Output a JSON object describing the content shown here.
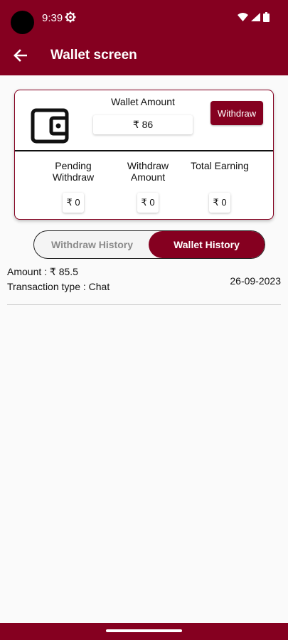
{
  "status_bar": {
    "time": "9:39",
    "icons": [
      "gear-icon",
      "wifi-icon",
      "signal-icon",
      "battery-icon"
    ]
  },
  "header": {
    "title": "Wallet screen",
    "back_icon": "arrow-left-icon"
  },
  "wallet_card": {
    "icon": "wallet-icon",
    "amount_label": "Wallet Amount",
    "amount_value": "₹ 86",
    "withdraw_button": "Withdraw",
    "stats": [
      {
        "label": "Pending Withdraw",
        "value": "₹ 0"
      },
      {
        "label": "Withdraw Amount",
        "value": "₹ 0"
      },
      {
        "label": "Total Earning",
        "value": "₹  0"
      }
    ]
  },
  "tabs": [
    {
      "label": "Withdraw History",
      "active": false
    },
    {
      "label": "Wallet History",
      "active": true
    }
  ],
  "transactions": [
    {
      "amount_label": "Amount : ",
      "amount": "₹ 85.5",
      "type_label": "Transaction type : ",
      "type": "Chat",
      "date": "26-09-2023"
    }
  ],
  "colors": {
    "primary": "#850020",
    "background": "#fafafa",
    "inactive_text": "#8a8a8a"
  }
}
